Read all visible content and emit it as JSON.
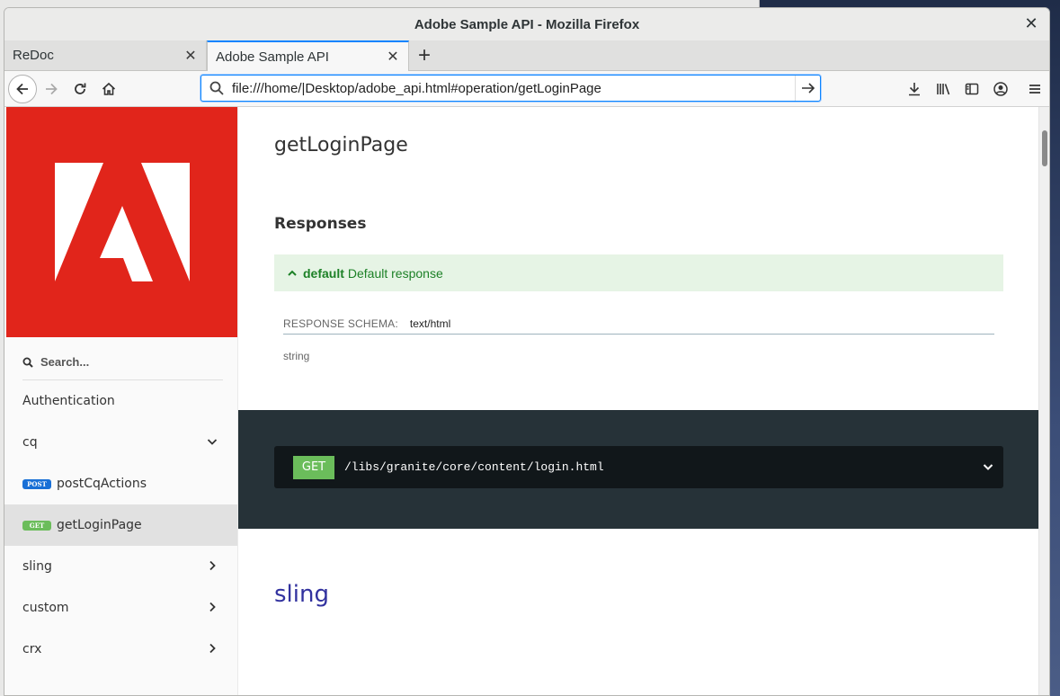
{
  "window": {
    "title": "Adobe Sample API - Mozilla Firefox",
    "close_glyph": "✕"
  },
  "tabs": [
    {
      "label": "ReDoc",
      "active": false
    },
    {
      "label": "Adobe Sample API",
      "active": true
    }
  ],
  "newtab_glyph": "+",
  "urlbar": {
    "value": "file:///home/|Desktop/adobe_api.html#operation/getLoginPage"
  },
  "sidebar": {
    "search_placeholder": "Search...",
    "items": [
      {
        "label": "Authentication",
        "badge": "",
        "chevron": "none",
        "active": false
      },
      {
        "label": "cq",
        "badge": "",
        "chevron": "down",
        "active": false
      },
      {
        "label": "postCqActions",
        "badge": "POST",
        "chevron": "none",
        "active": false
      },
      {
        "label": "getLoginPage",
        "badge": "GET",
        "chevron": "none",
        "active": true
      },
      {
        "label": "sling",
        "badge": "",
        "chevron": "right",
        "active": false
      },
      {
        "label": "custom",
        "badge": "",
        "chevron": "right",
        "active": false
      },
      {
        "label": "crx",
        "badge": "",
        "chevron": "right",
        "active": false
      }
    ]
  },
  "main": {
    "operation_title": "getLoginPage",
    "responses_title": "Responses",
    "response": {
      "code": "default",
      "description": "Default response"
    },
    "schema_label": "RESPONSE SCHEMA:",
    "schema_value": "text/html",
    "schema_type": "string",
    "endpoint": {
      "method": "GET",
      "path": "/libs/granite/core/content/login.html"
    },
    "next_section_title": "sling"
  },
  "colors": {
    "accent_blue": "#0a84ff",
    "adobe_red": "#e1251b",
    "get_green": "#6bbd5b",
    "post_blue": "#186fd6",
    "dark_panel": "#263238",
    "section_purple": "#32329f"
  }
}
